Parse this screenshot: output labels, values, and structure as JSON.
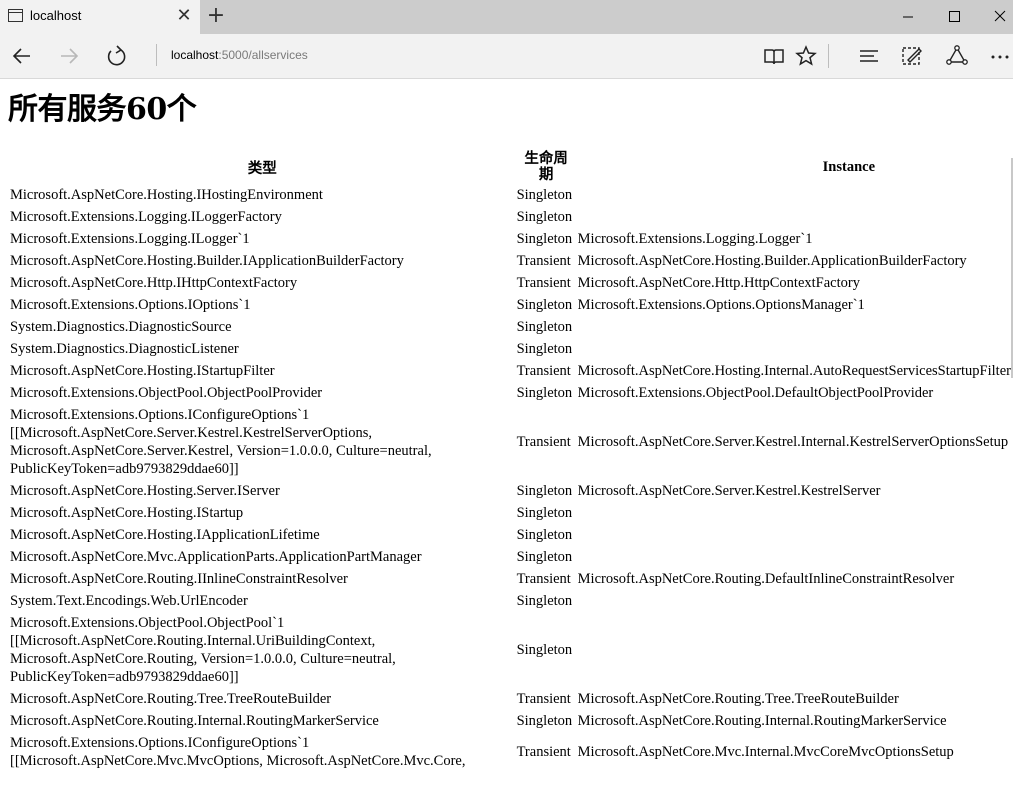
{
  "browser": {
    "tab_title": "localhost",
    "url_host": "localhost",
    "url_rest": ":5000/allservices",
    "icons": [
      "page-icon",
      "close-icon",
      "plus-icon",
      "minimize-icon",
      "maximize-icon",
      "close-window-icon",
      "back-icon",
      "forward-icon",
      "refresh-icon",
      "reading-view-icon",
      "favorite-star-icon",
      "hub-icon",
      "web-note-icon",
      "share-icon",
      "more-icon"
    ]
  },
  "page": {
    "title": "所有服务60个",
    "headers": {
      "type": "类型",
      "lifetime": "生命周期",
      "instance": "Instance"
    },
    "rows": [
      {
        "type": "Microsoft.AspNetCore.Hosting.IHostingEnvironment",
        "lifetime": "Singleton",
        "instance": ""
      },
      {
        "type": "Microsoft.Extensions.Logging.ILoggerFactory",
        "lifetime": "Singleton",
        "instance": ""
      },
      {
        "type": "Microsoft.Extensions.Logging.ILogger`1",
        "lifetime": "Singleton",
        "instance": "Microsoft.Extensions.Logging.Logger`1"
      },
      {
        "type": "Microsoft.AspNetCore.Hosting.Builder.IApplicationBuilderFactory",
        "lifetime": "Transient",
        "instance": "Microsoft.AspNetCore.Hosting.Builder.ApplicationBuilderFactory"
      },
      {
        "type": "Microsoft.AspNetCore.Http.IHttpContextFactory",
        "lifetime": "Transient",
        "instance": "Microsoft.AspNetCore.Http.HttpContextFactory"
      },
      {
        "type": "Microsoft.Extensions.Options.IOptions`1",
        "lifetime": "Singleton",
        "instance": "Microsoft.Extensions.Options.OptionsManager`1"
      },
      {
        "type": "System.Diagnostics.DiagnosticSource",
        "lifetime": "Singleton",
        "instance": ""
      },
      {
        "type": "System.Diagnostics.DiagnosticListener",
        "lifetime": "Singleton",
        "instance": ""
      },
      {
        "type": "Microsoft.AspNetCore.Hosting.IStartupFilter",
        "lifetime": "Transient",
        "instance": "Microsoft.AspNetCore.Hosting.Internal.AutoRequestServicesStartupFilter"
      },
      {
        "type": "Microsoft.Extensions.ObjectPool.ObjectPoolProvider",
        "lifetime": "Singleton",
        "instance": "Microsoft.Extensions.ObjectPool.DefaultObjectPoolProvider"
      },
      {
        "type": "Microsoft.Extensions.Options.IConfigureOptions`1 [[Microsoft.AspNetCore.Server.Kestrel.KestrelServerOptions, Microsoft.AspNetCore.Server.Kestrel, Version=1.0.0.0, Culture=neutral, PublicKeyToken=adb9793829ddae60]]",
        "lifetime": "Transient",
        "instance": "Microsoft.AspNetCore.Server.Kestrel.Internal.KestrelServerOptionsSetup"
      },
      {
        "type": "Microsoft.AspNetCore.Hosting.Server.IServer",
        "lifetime": "Singleton",
        "instance": "Microsoft.AspNetCore.Server.Kestrel.KestrelServer"
      },
      {
        "type": "Microsoft.AspNetCore.Hosting.IStartup",
        "lifetime": "Singleton",
        "instance": ""
      },
      {
        "type": "Microsoft.AspNetCore.Hosting.IApplicationLifetime",
        "lifetime": "Singleton",
        "instance": ""
      },
      {
        "type": "Microsoft.AspNetCore.Mvc.ApplicationParts.ApplicationPartManager",
        "lifetime": "Singleton",
        "instance": ""
      },
      {
        "type": "Microsoft.AspNetCore.Routing.IInlineConstraintResolver",
        "lifetime": "Transient",
        "instance": "Microsoft.AspNetCore.Routing.DefaultInlineConstraintResolver"
      },
      {
        "type": "System.Text.Encodings.Web.UrlEncoder",
        "lifetime": "Singleton",
        "instance": ""
      },
      {
        "type": "Microsoft.Extensions.ObjectPool.ObjectPool`1 [[Microsoft.AspNetCore.Routing.Internal.UriBuildingContext, Microsoft.AspNetCore.Routing, Version=1.0.0.0, Culture=neutral, PublicKeyToken=adb9793829ddae60]]",
        "lifetime": "Singleton",
        "instance": ""
      },
      {
        "type": "Microsoft.AspNetCore.Routing.Tree.TreeRouteBuilder",
        "lifetime": "Transient",
        "instance": "Microsoft.AspNetCore.Routing.Tree.TreeRouteBuilder"
      },
      {
        "type": "Microsoft.AspNetCore.Routing.Internal.RoutingMarkerService",
        "lifetime": "Singleton",
        "instance": "Microsoft.AspNetCore.Routing.Internal.RoutingMarkerService"
      },
      {
        "type": "Microsoft.Extensions.Options.IConfigureOptions`1 [[Microsoft.AspNetCore.Mvc.MvcOptions, Microsoft.AspNetCore.Mvc.Core,",
        "lifetime": "Transient",
        "instance": "Microsoft.AspNetCore.Mvc.Internal.MvcCoreMvcOptionsSetup"
      }
    ]
  }
}
